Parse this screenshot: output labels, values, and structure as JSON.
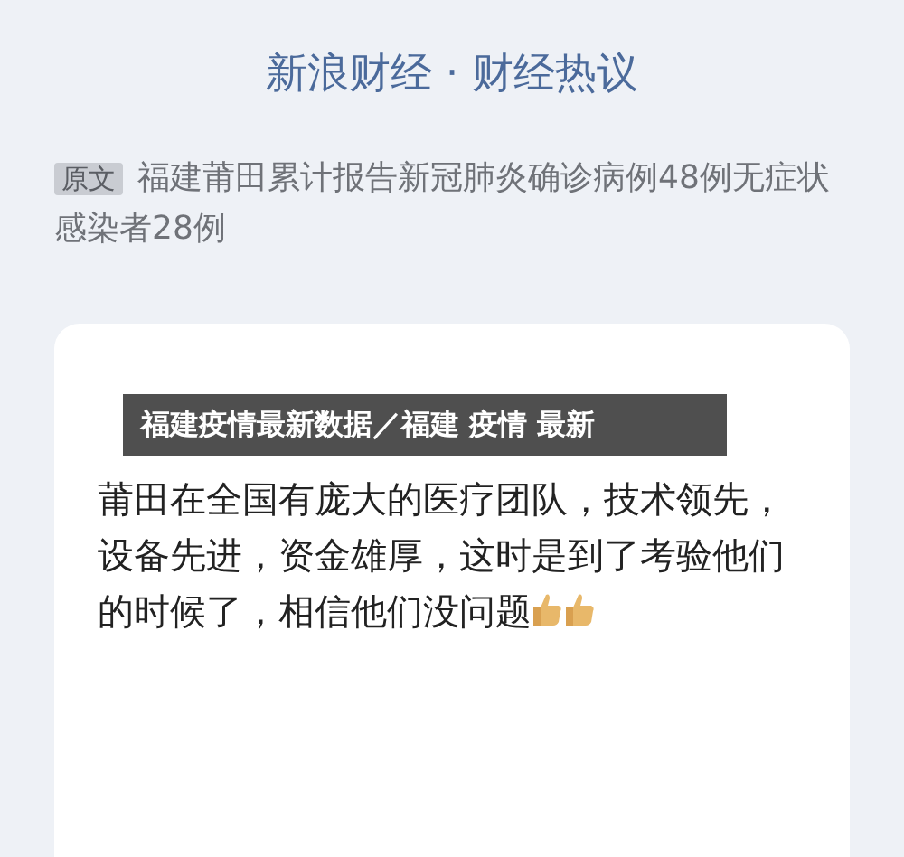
{
  "header": {
    "title": "新浪财经 · 财经热议"
  },
  "source": {
    "tag": "原文",
    "text": "福建莆田累计报告新冠肺炎确诊病例48例无症状感染者28例"
  },
  "banner": {
    "text": "福建疫情最新数据／福建 疫情 最新"
  },
  "comment": {
    "text": "莆田在全国有庞大的医疗团队，技术领先，设备先进，资金雄厚，这时是到了考验他们的时候了，相信他们没问题"
  }
}
